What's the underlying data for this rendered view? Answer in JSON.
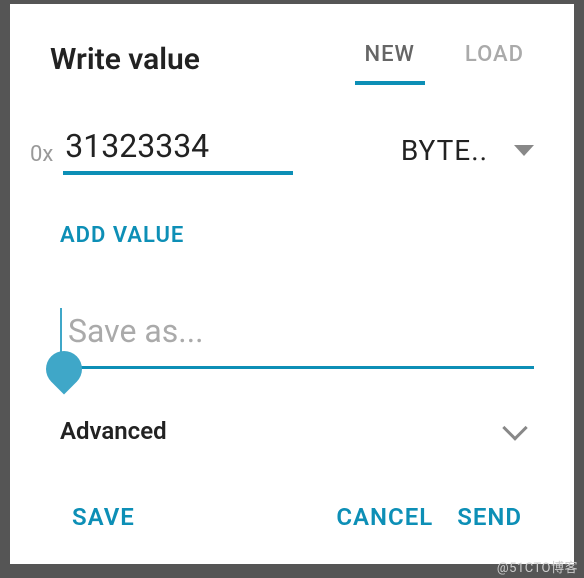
{
  "header": {
    "title": "Write value",
    "tabs": {
      "new": "NEW",
      "load": "LOAD"
    }
  },
  "value": {
    "prefix": "0x",
    "input": "31323334",
    "type_label": "BYTE.."
  },
  "add_value_label": "ADD VALUE",
  "saveas": {
    "placeholder": "Save as...",
    "value": ""
  },
  "advanced_label": "Advanced",
  "actions": {
    "save": "SAVE",
    "cancel": "CANCEL",
    "send": "SEND"
  },
  "watermark": "@51CTO博客"
}
